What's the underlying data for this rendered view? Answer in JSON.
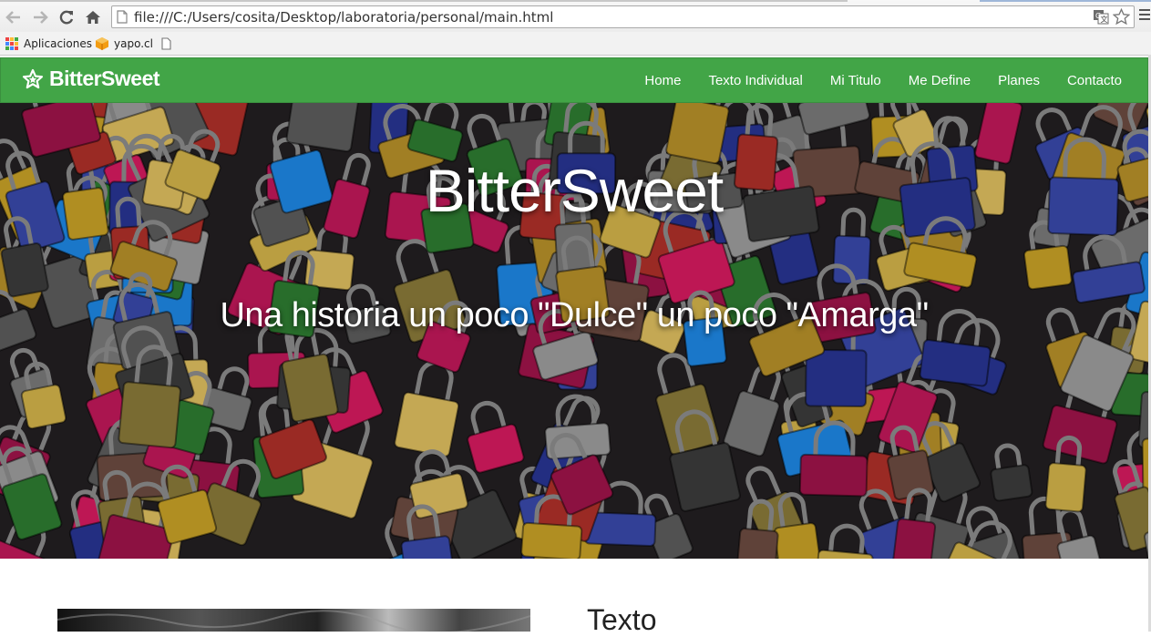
{
  "browser": {
    "url": "file:///C:/Users/cosita/Desktop/laboratoria/personal/main.html",
    "bookmarks": [
      {
        "label": "Aplicaciones",
        "icon": "apps-grid-icon"
      },
      {
        "label": "yapo.cl",
        "icon": "yapo-favicon-icon"
      },
      {
        "label": "",
        "icon": "page-icon"
      }
    ]
  },
  "navbar": {
    "brand": "BitterSweet",
    "brand_icon": "star-icon",
    "color": "#42a547",
    "links": [
      "Home",
      "Texto Individual",
      "Mi Titulo",
      "Me Define",
      "Planes",
      "Contacto"
    ]
  },
  "hero": {
    "title": "BitterSweet",
    "subtitle": "Una historia un poco \"Dulce\" un poco \"Amarga\""
  },
  "content": {
    "heading": "Texto"
  }
}
